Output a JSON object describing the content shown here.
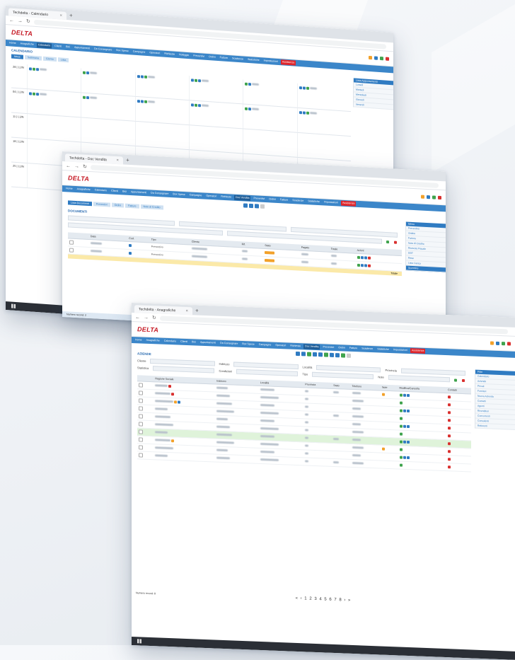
{
  "brand": {
    "logo": "DELTA"
  },
  "windows": {
    "w1": {
      "tab": "Techdelta - Calendario",
      "menu": [
        "Home",
        "Anagrafiche",
        "Calendario",
        "Clienti",
        "Bici",
        "Appuntamenti",
        "Da Consegnare",
        "Box Spese",
        "Campagne",
        "Operatori",
        "Richieste",
        "Noleggio",
        "Preventivi",
        "Ordini",
        "Fatture",
        "Scadenze",
        "Statistiche",
        "Impostazioni",
        "Assistenza"
      ],
      "section": "CALENDARIO",
      "subtabs": [
        "Mese",
        "Settimana",
        "Giorno",
        "Lista"
      ],
      "days": [
        "28 | LUN",
        "04 | LUN",
        "11 | LUN",
        "18 | LUN",
        "25 | LUN"
      ],
      "side_header": "Lista Appuntamenti",
      "side_items": [
        "Lunedì",
        "Martedì",
        "Mercoledì",
        "Giovedì",
        "Venerdì"
      ]
    },
    "w2": {
      "tab": "Techdelta - Doc Vendita",
      "menu": [
        "Home",
        "Anagrafiche",
        "Calendario",
        "Clienti",
        "Bici",
        "Appuntamenti",
        "Da Consegnare",
        "Box Spese",
        "Campagne",
        "Operatori",
        "Richieste",
        "Doc Vendita",
        "Preventivi",
        "Ordini",
        "Fatture",
        "Scadenze",
        "Statistiche",
        "Impostazioni",
        "Assistenza"
      ],
      "section": "DOCUMENTI",
      "subtabs": [
        "Lista Documenti",
        "Preventivi",
        "Ordini",
        "Fatture",
        "Note di Credito"
      ],
      "columns": [
        "",
        "Data",
        "Cod.",
        "Tipo",
        "Cliente",
        "Rif.",
        "Stato",
        "Pagato",
        "Totale",
        "Azioni"
      ],
      "rows": [
        {
          "tipo": "Preventivo"
        },
        {
          "tipo": "Preventivo"
        }
      ],
      "total_label": "Totale",
      "status": "Numero record: 2",
      "side_header": "Menu",
      "side_items": [
        "Preventivo",
        "Ordine",
        "Fattura",
        "Nota di Credito",
        "Ricevuta Fiscale",
        "DDT",
        "Reso",
        "Lista Carico",
        "Scontrino"
      ]
    },
    "w3": {
      "tab": "Techdelta - Anagrafiche",
      "menu": [
        "Home",
        "Anagrafiche",
        "Calendario",
        "Clienti",
        "Bici",
        "Appuntamenti",
        "Da Consegnare",
        "Box Spese",
        "Campagne",
        "Operatori",
        "Richieste",
        "Doc Vendita",
        "Preventivi",
        "Ordini",
        "Fatture",
        "Scadenze",
        "Statistiche",
        "Impostazioni",
        "Assistenza"
      ],
      "section": "AZIENDE",
      "filter_labels": [
        "Cliente",
        "Indirizzo",
        "Località",
        "Provincia",
        "Statistica",
        "Condizioni",
        "Tipo",
        "Note"
      ],
      "columns": [
        "",
        "Ragione Sociale",
        "Indirizzo",
        "Località",
        "Provincia",
        "Stato",
        "Telefono",
        "Note",
        "Modifica/Cancella",
        "Contatti"
      ],
      "row_count": 10,
      "status": "Numero record: 8",
      "pager": "« ‹ 1 2 3 4 5 6 7 8 › »",
      "side_header": "Filtri",
      "side_items": [
        "Calendario",
        "Aziende",
        "Privati",
        "Fornitori",
        "Nuova Azienda",
        "Contatti",
        "Agenti",
        "Rivenditori",
        "Concorrenti",
        "Consulenti",
        "Referenti"
      ]
    }
  },
  "colors": {
    "menu": "#3b86c9",
    "accent_red": "#e0262b",
    "green": "#3fa34d",
    "orange": "#f2a12a"
  }
}
